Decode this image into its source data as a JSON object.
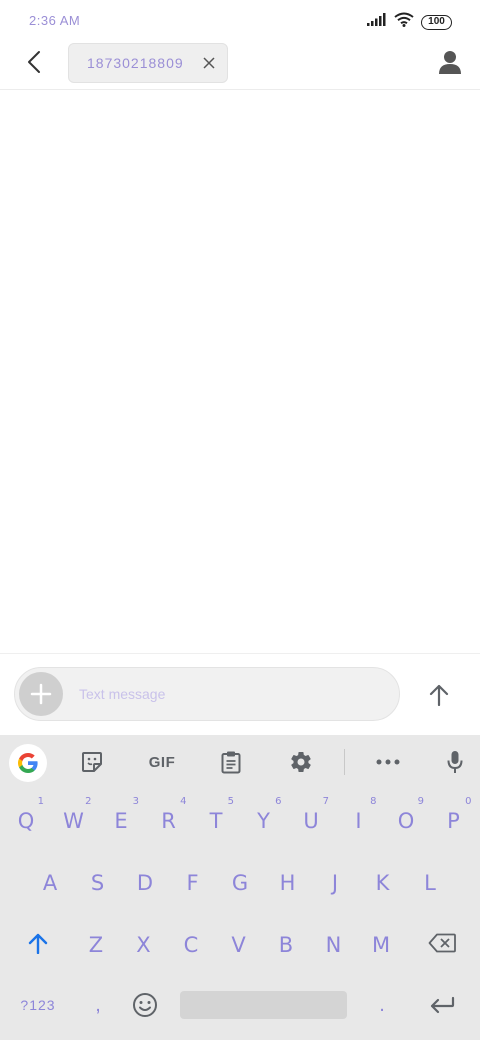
{
  "status": {
    "time": "2:36 AM",
    "battery": "100"
  },
  "header": {
    "recipient": "18730218809",
    "back_icon": "back-arrow-icon",
    "contact_icon": "person-icon"
  },
  "compose": {
    "placeholder": "Text message"
  },
  "keyboard": {
    "toolbar": {
      "gif_label": "GIF"
    },
    "row1": [
      {
        "label": "Q",
        "hint": "1"
      },
      {
        "label": "W",
        "hint": "2"
      },
      {
        "label": "E",
        "hint": "3"
      },
      {
        "label": "R",
        "hint": "4"
      },
      {
        "label": "T",
        "hint": "5"
      },
      {
        "label": "Y",
        "hint": "6"
      },
      {
        "label": "U",
        "hint": "7"
      },
      {
        "label": "I",
        "hint": "8"
      },
      {
        "label": "O",
        "hint": "9"
      },
      {
        "label": "P",
        "hint": "0"
      }
    ],
    "row2": [
      "A",
      "S",
      "D",
      "F",
      "G",
      "H",
      "J",
      "K",
      "L"
    ],
    "row3": [
      "Z",
      "X",
      "C",
      "V",
      "B",
      "N",
      "M"
    ],
    "bottom": {
      "symbols": "?123",
      "comma": ",",
      "period": "."
    }
  },
  "colors": {
    "accent": "#8d85d9",
    "send_arrow": "#5f6368",
    "shift": "#1a73e8"
  }
}
